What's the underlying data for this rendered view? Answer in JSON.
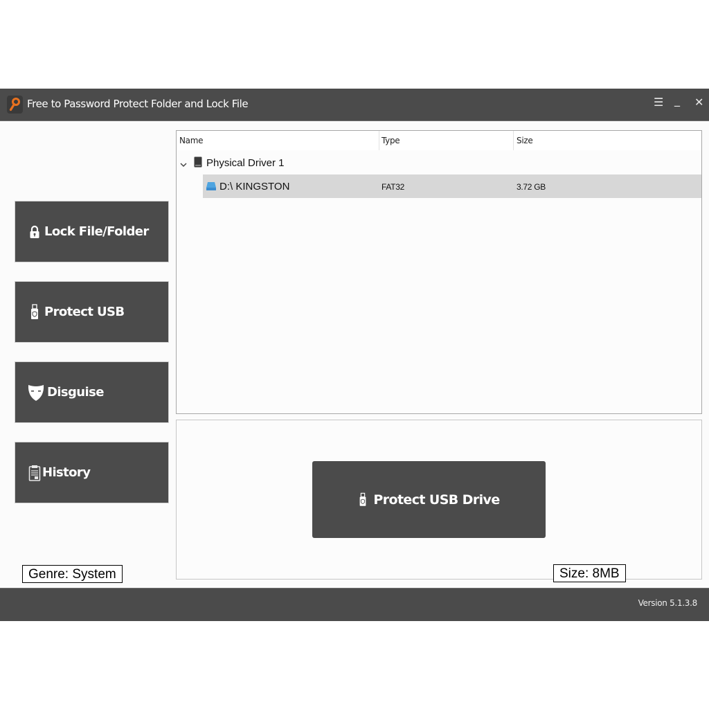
{
  "window": {
    "title": "Free to Password Protect Folder and Lock File",
    "app_icon": "key-icon",
    "controls": {
      "menu": "☰",
      "minimize": "_",
      "close": "✕"
    }
  },
  "sidebar": {
    "items": [
      {
        "label": "Lock File/Folder",
        "icon": "lock-icon"
      },
      {
        "label": "Protect USB",
        "icon": "usb-icon"
      },
      {
        "label": "Disguise",
        "icon": "mask-icon"
      },
      {
        "label": "History",
        "icon": "clipboard-icon"
      }
    ]
  },
  "drive_list": {
    "columns": [
      "Name",
      "Type",
      "Size"
    ],
    "tree": {
      "parent": {
        "name": "Physical Driver 1",
        "expanded": true,
        "icon": "hard-drive-icon"
      },
      "children": [
        {
          "name": "D:\\ KINGSTON",
          "type": "FAT32",
          "size": "3.72 GB",
          "selected": true,
          "icon": "usb-drive-icon"
        }
      ]
    }
  },
  "action": {
    "protect_button": "Protect USB Drive"
  },
  "status": {
    "version": "Version 5.1.3.8"
  },
  "overlays": {
    "genre": "Genre: System",
    "size": "Size: 8MB"
  },
  "colors": {
    "dark": "#4b4b4b",
    "accent": "#e8711f",
    "selected_row": "#d7d7d7",
    "drive_blue": "#4ea4e0"
  }
}
